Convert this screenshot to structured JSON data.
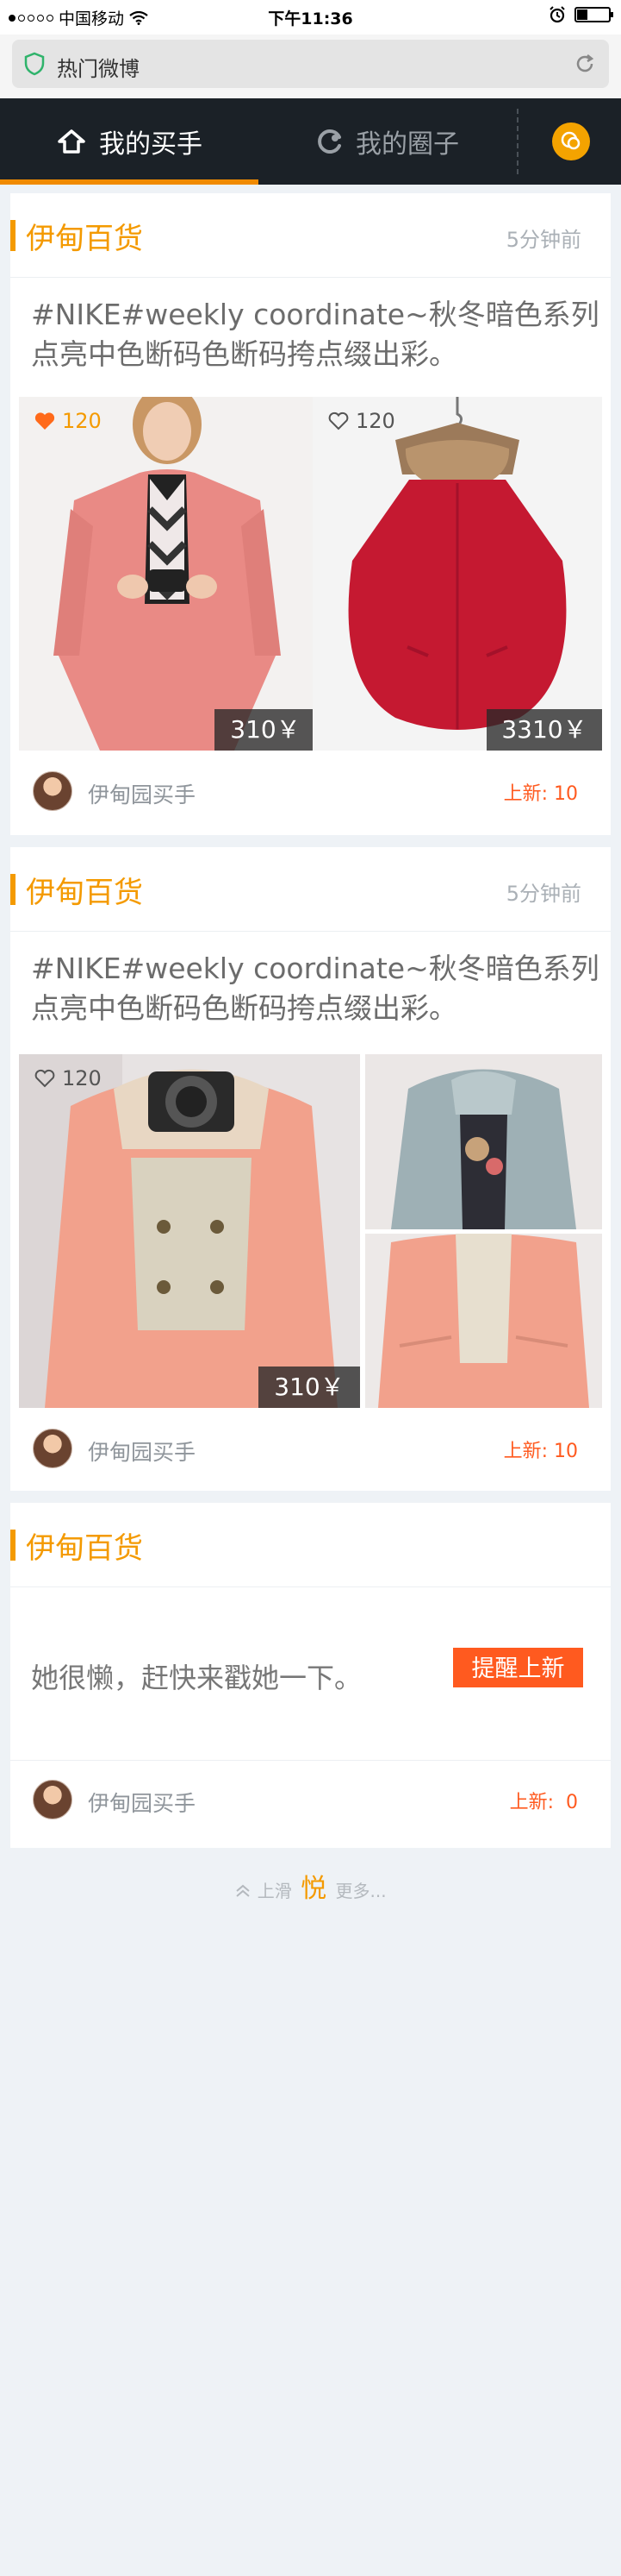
{
  "status_bar": {
    "carrier": "中国移动",
    "time": "下午11:36"
  },
  "browser": {
    "title": "热门微博"
  },
  "tabs": [
    {
      "label": "我的买手",
      "active": true
    },
    {
      "label": "我的圈子",
      "active": false
    }
  ],
  "colors": {
    "accent": "#f49a00",
    "update": "#ff5a1f",
    "tabbar": "#1b2127"
  },
  "cards": [
    {
      "shop": "伊甸百货",
      "time": "5分钟前",
      "desc": "#NIKE#weekly coordinate~秋冬暗色系列点亮中色断码色断码挎点缀出彩。",
      "images": [
        {
          "like_count": "120",
          "liked": true,
          "price": "310￥",
          "subject": "pink long coat"
        },
        {
          "like_count": "120",
          "liked": false,
          "price": "3310￥",
          "subject": "red fur-collar cape"
        }
      ],
      "buyer": "伊甸园买手",
      "update": "上新: 10"
    },
    {
      "shop": "伊甸百货",
      "time": "5分钟前",
      "desc": "#NIKE#weekly coordinate~秋冬暗色系列点亮中色断码色断码挎点缀出彩。",
      "images": [
        {
          "like_count": "120",
          "liked": false,
          "price": "310￥",
          "subject": "pink hooded jacket"
        },
        {
          "subject": "grey hooded jacket"
        },
        {
          "subject": "pink jacket"
        }
      ],
      "buyer": "伊甸园买手",
      "update": "上新: 10"
    },
    {
      "shop": "伊甸百货",
      "lazy_text": "她很懒，赶快来戳她一下。",
      "remind_label": "提醒上新",
      "buyer": "伊甸园买手",
      "update": "上新:  0"
    }
  ],
  "more": {
    "prefix": "上滑",
    "brand": "悦",
    "suffix": "更多..."
  }
}
